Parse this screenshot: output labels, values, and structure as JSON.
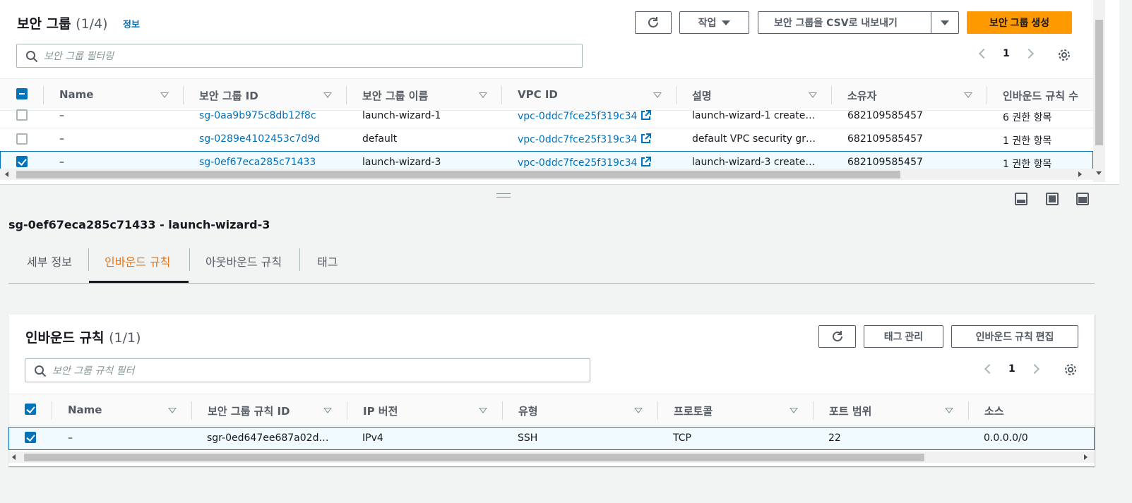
{
  "security_groups": {
    "title": "보안 그룹",
    "count": "(1/4)",
    "info_link": "정보",
    "actions_label": "작업",
    "export_label": "보안 그룹을 CSV로 내보내기",
    "create_label": "보안 그룹 생성",
    "search_placeholder": "보안 그룹 필터링",
    "page_number": "1",
    "columns": [
      "Name",
      "보안 그룹 ID",
      "보안 그룹 이름",
      "VPC ID",
      "설명",
      "소유자",
      "인바운드 규칙 수"
    ],
    "rows": [
      {
        "name": "–",
        "id": "sg-0aa9b975c8db12f8c",
        "group_name": "launch-wizard-1",
        "vpc": "vpc-0ddc7fce25f319c34",
        "desc": "launch-wizard-1 create…",
        "owner": "682109585457",
        "rules": "6 권한 항목"
      },
      {
        "name": "–",
        "id": "sg-0289e4102453c7d9d",
        "group_name": "default",
        "vpc": "vpc-0ddc7fce25f319c34",
        "desc": "default VPC security gr…",
        "owner": "682109585457",
        "rules": "1 권한 항목"
      },
      {
        "name": "–",
        "id": "sg-0ef67eca285c71433",
        "group_name": "launch-wizard-3",
        "vpc": "vpc-0ddc7fce25f319c34",
        "desc": "launch-wizard-3 create…",
        "owner": "682109585457",
        "rules": "1 권한 항목"
      }
    ]
  },
  "detail": {
    "title": "sg-0ef67eca285c71433 - launch-wizard-3",
    "tabs": [
      "세부 정보",
      "인바운드 규칙",
      "아웃바운드 규칙",
      "태그"
    ],
    "active_tab": "인바운드 규칙"
  },
  "inbound": {
    "title": "인바운드 규칙",
    "count": "(1/1)",
    "manage_tags_label": "태그 관리",
    "edit_label": "인바운드 규칙 편집",
    "search_placeholder": "보안 그룹 규칙 필터",
    "page_number": "1",
    "columns": [
      "Name",
      "보안 그룹 규칙 ID",
      "IP 버전",
      "유형",
      "프로토콜",
      "포트 범위",
      "소스"
    ],
    "rows": [
      {
        "name": "–",
        "rule_id": "sgr-0ed647ee687a02d…",
        "ip": "IPv4",
        "type": "SSH",
        "protocol": "TCP",
        "port": "22",
        "source": "0.0.0.0/0"
      }
    ]
  },
  "colors": {
    "accent": "#ff9900",
    "link": "#0073bb",
    "active_tab": "#ec7211"
  },
  "icons": [
    "refresh-icon",
    "search-icon",
    "gear-icon",
    "external-link-icon",
    "caret-down-icon"
  ]
}
